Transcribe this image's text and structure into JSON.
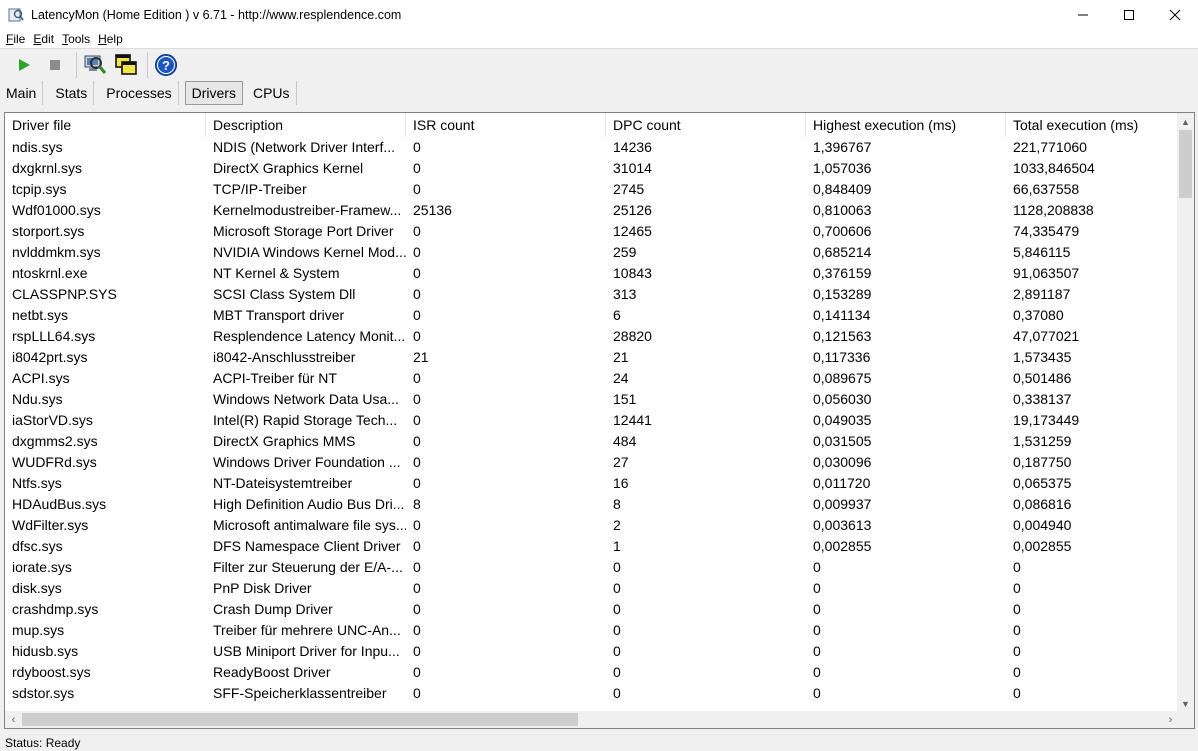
{
  "window": {
    "title": "LatencyMon  (Home Edition )  v 6.71 - http://www.resplendence.com",
    "minimize": "—",
    "maximize": "☐",
    "close": "✕"
  },
  "menu": {
    "items": [
      {
        "key": "F",
        "rest": "ile"
      },
      {
        "key": "E",
        "rest": "dit"
      },
      {
        "key": "T",
        "rest": "ools"
      },
      {
        "key": "H",
        "rest": "elp"
      }
    ]
  },
  "toolbar": {
    "icons": [
      "play-icon",
      "stop-icon",
      "magnifier-computer-icon",
      "windows-overlap-icon",
      "help-icon"
    ],
    "colors": {
      "play": "#2aa52a",
      "stop": "#8c8c8c",
      "help": "#1a55c0"
    }
  },
  "tabs": [
    {
      "label": "Main",
      "active": false
    },
    {
      "label": "Stats",
      "active": false
    },
    {
      "label": "Processes",
      "active": false
    },
    {
      "label": "Drivers",
      "active": true
    },
    {
      "label": "CPUs",
      "active": false
    }
  ],
  "grid": {
    "columns": [
      "Driver file",
      "Description",
      "ISR count",
      "DPC count",
      "Highest execution (ms)",
      "Total execution (ms)"
    ],
    "rows": [
      [
        "ndis.sys",
        "NDIS (Network Driver Interf...",
        "0",
        "14236",
        "1,396767",
        "221,771060"
      ],
      [
        "dxgkrnl.sys",
        "DirectX Graphics Kernel",
        "0",
        "31014",
        "1,057036",
        "1033,846504"
      ],
      [
        "tcpip.sys",
        "TCP/IP-Treiber",
        "0",
        "2745",
        "0,848409",
        "66,637558"
      ],
      [
        "Wdf01000.sys",
        "Kernelmodustreiber-Framew...",
        "25136",
        "25126",
        "0,810063",
        "1128,208838"
      ],
      [
        "storport.sys",
        "Microsoft Storage Port Driver",
        "0",
        "12465",
        "0,700606",
        "74,335479"
      ],
      [
        "nvlddmkm.sys",
        "NVIDIA Windows Kernel Mod...",
        "0",
        "259",
        "0,685214",
        "5,846115"
      ],
      [
        "ntoskrnl.exe",
        "NT Kernel & System",
        "0",
        "10843",
        "0,376159",
        "91,063507"
      ],
      [
        "CLASSPNP.SYS",
        "SCSI Class System Dll",
        "0",
        "313",
        "0,153289",
        "2,891187"
      ],
      [
        "netbt.sys",
        "MBT Transport driver",
        "0",
        "6",
        "0,141134",
        "0,37080"
      ],
      [
        "rspLLL64.sys",
        "Resplendence Latency Monit...",
        "0",
        "28820",
        "0,121563",
        "47,077021"
      ],
      [
        "i8042prt.sys",
        "i8042-Anschlusstreiber",
        "21",
        "21",
        "0,117336",
        "1,573435"
      ],
      [
        "ACPI.sys",
        "ACPI-Treiber für NT",
        "0",
        "24",
        "0,089675",
        "0,501486"
      ],
      [
        "Ndu.sys",
        "Windows Network Data Usa...",
        "0",
        "151",
        "0,056030",
        "0,338137"
      ],
      [
        "iaStorVD.sys",
        "Intel(R) Rapid Storage Tech...",
        "0",
        "12441",
        "0,049035",
        "19,173449"
      ],
      [
        "dxgmms2.sys",
        "DirectX Graphics MMS",
        "0",
        "484",
        "0,031505",
        "1,531259"
      ],
      [
        "WUDFRd.sys",
        "Windows Driver Foundation ...",
        "0",
        "27",
        "0,030096",
        "0,187750"
      ],
      [
        "Ntfs.sys",
        "NT-Dateisystemtreiber",
        "0",
        "16",
        "0,011720",
        "0,065375"
      ],
      [
        "HDAudBus.sys",
        "High Definition Audio Bus Dri...",
        "8",
        "8",
        "0,009937",
        "0,086816"
      ],
      [
        "WdFilter.sys",
        "Microsoft antimalware file sys...",
        "0",
        "2",
        "0,003613",
        "0,004940"
      ],
      [
        "dfsc.sys",
        "DFS Namespace Client Driver",
        "0",
        "1",
        "0,002855",
        "0,002855"
      ],
      [
        "iorate.sys",
        "Filter zur Steuerung der E/A-...",
        "0",
        "0",
        "0",
        "0"
      ],
      [
        "disk.sys",
        "PnP Disk Driver",
        "0",
        "0",
        "0",
        "0"
      ],
      [
        "crashdmp.sys",
        "Crash Dump Driver",
        "0",
        "0",
        "0",
        "0"
      ],
      [
        "mup.sys",
        "Treiber für mehrere UNC-An...",
        "0",
        "0",
        "0",
        "0"
      ],
      [
        "hidusb.sys",
        "USB Miniport Driver for Inpu...",
        "0",
        "0",
        "0",
        "0"
      ],
      [
        "rdyboost.sys",
        "ReadyBoost Driver",
        "0",
        "0",
        "0",
        "0"
      ],
      [
        "sdstor.sys",
        "SFF-Speicherklassentreiber",
        "0",
        "0",
        "0",
        "0"
      ]
    ]
  },
  "status": {
    "text": "Status: Ready"
  }
}
